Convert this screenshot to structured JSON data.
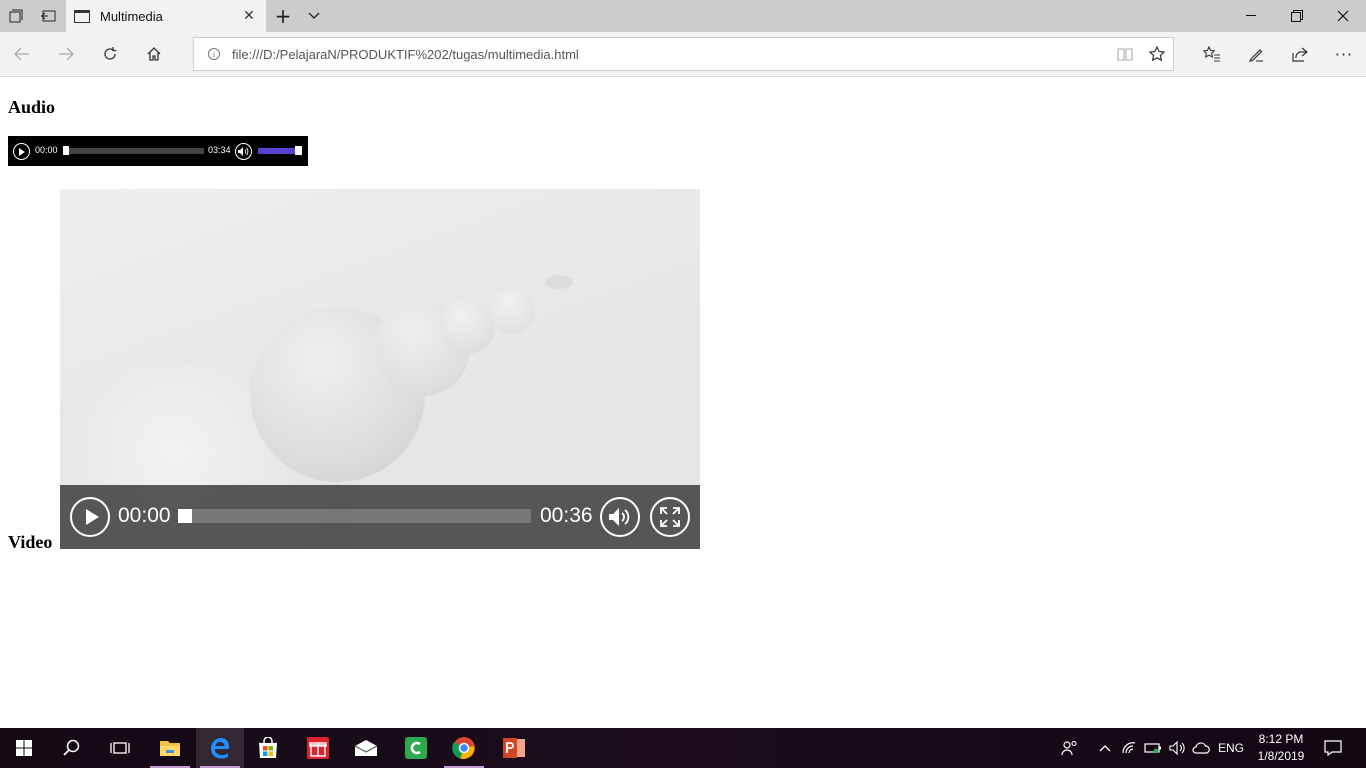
{
  "browser": {
    "tab_title": "Multimedia",
    "address": "file:///D:/PelajaraN/PRODUKTIF%202/tugas/multimedia.html"
  },
  "page": {
    "audio_heading": "Audio",
    "video_heading": "Video",
    "audio_player": {
      "current_time": "00:00",
      "duration": "03:34",
      "volume_level": 0.85
    },
    "video_player": {
      "current_time": "00:00",
      "duration": "00:36"
    }
  },
  "taskbar": {
    "language": "ENG",
    "time": "8:12 PM",
    "date": "1/8/2019"
  },
  "colors": {
    "audio_volume_fill": "#5b3fd3",
    "taskbar_active_underline": "#c29bd6"
  }
}
